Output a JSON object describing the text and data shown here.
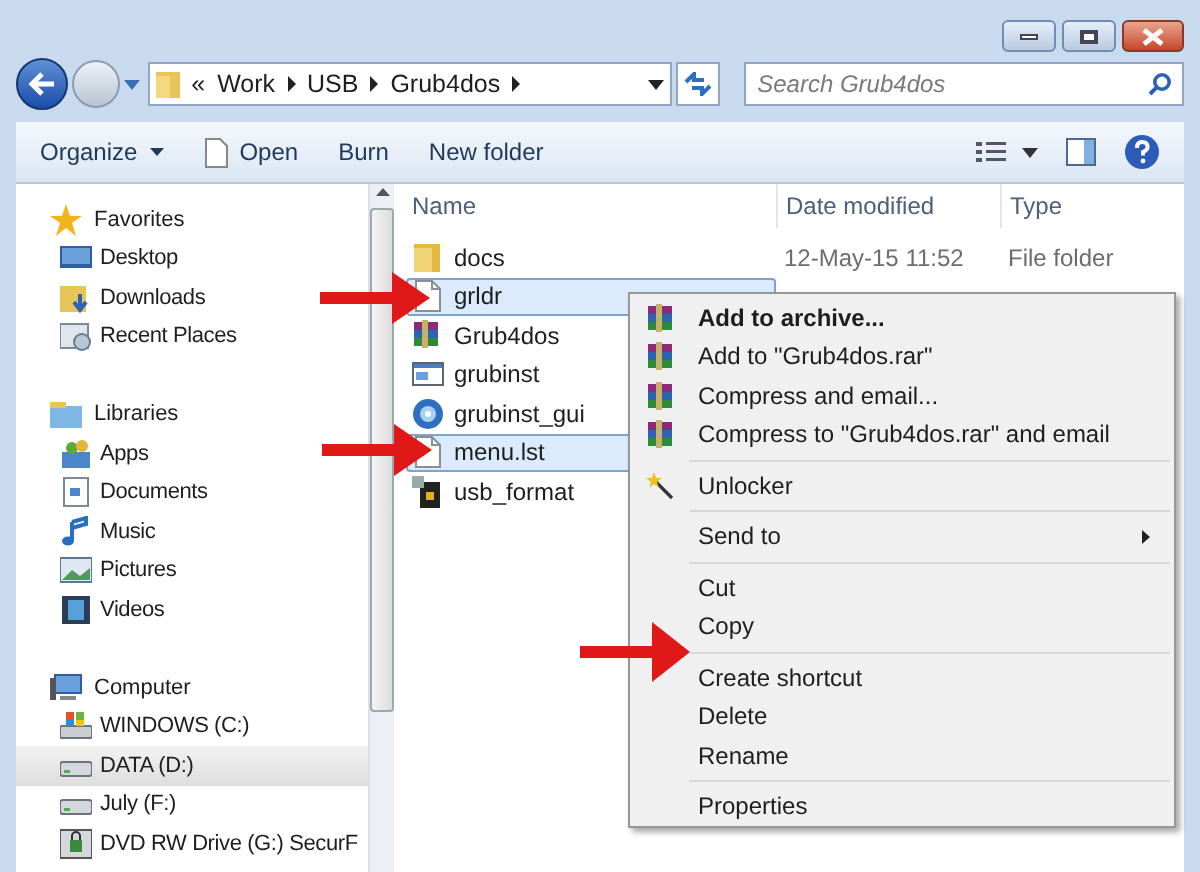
{
  "address_bar": {
    "overflow": "«",
    "crumbs": [
      "Work",
      "USB",
      "Grub4dos"
    ]
  },
  "search": {
    "placeholder": "Search Grub4dos"
  },
  "toolbar": [
    {
      "label": "Organize",
      "dropdown": true
    },
    {
      "label": "Open",
      "dropdown": false
    },
    {
      "label": "Burn",
      "dropdown": false
    },
    {
      "label": "New folder",
      "dropdown": false
    }
  ],
  "sidebar": {
    "groups": [
      {
        "label": "Favorites",
        "children": [
          {
            "label": "Desktop",
            "selected": false
          },
          {
            "label": "Downloads",
            "selected": false
          },
          {
            "label": "Recent Places",
            "selected": false
          }
        ]
      },
      {
        "label": "Libraries",
        "children": [
          {
            "label": "Apps",
            "selected": false
          },
          {
            "label": "Documents",
            "selected": false
          },
          {
            "label": "Music",
            "selected": false
          },
          {
            "label": "Pictures",
            "selected": false
          },
          {
            "label": "Videos",
            "selected": false
          }
        ]
      },
      {
        "label": "Computer",
        "children": [
          {
            "label": "WINDOWS (C:)",
            "selected": false
          },
          {
            "label": "DATA (D:)",
            "selected": true
          },
          {
            "label": "July (F:)",
            "selected": false
          },
          {
            "label": "DVD RW Drive (G:) SecurF",
            "selected": false
          }
        ]
      }
    ]
  },
  "file_list": {
    "columns": [
      "Name",
      "Date modified",
      "Type"
    ],
    "rows": [
      {
        "name": "docs",
        "date": "12-May-15 11:52",
        "type": "File folder",
        "selected": false
      },
      {
        "name": "grldr",
        "selected": true
      },
      {
        "name": "Grub4dos",
        "selected": false
      },
      {
        "name": "grubinst",
        "selected": false
      },
      {
        "name": "grubinst_gui",
        "selected": false
      },
      {
        "name": "menu.lst",
        "selected": true
      },
      {
        "name": "usb_format",
        "selected": false
      }
    ]
  },
  "context_menu": {
    "groups": [
      [
        {
          "label": "Add to archive...",
          "default": true,
          "submenu": false
        },
        {
          "label": "Add to \"Grub4dos.rar\"",
          "default": false,
          "submenu": false
        },
        {
          "label": "Compress and email...",
          "default": false,
          "submenu": false
        },
        {
          "label": "Compress to \"Grub4dos.rar\" and email",
          "default": false,
          "submenu": false
        }
      ],
      [
        {
          "label": "Unlocker",
          "default": false,
          "submenu": false
        }
      ],
      [
        {
          "label": "Send to",
          "default": false,
          "submenu": true
        }
      ],
      [
        {
          "label": "Cut",
          "default": false,
          "submenu": false
        },
        {
          "label": "Copy",
          "default": false,
          "submenu": false
        }
      ],
      [
        {
          "label": "Create shortcut",
          "default": false,
          "submenu": false
        },
        {
          "label": "Delete",
          "default": false,
          "submenu": false
        },
        {
          "label": "Rename",
          "default": false,
          "submenu": false
        }
      ],
      [
        {
          "label": "Properties",
          "default": false,
          "submenu": false
        }
      ]
    ]
  }
}
